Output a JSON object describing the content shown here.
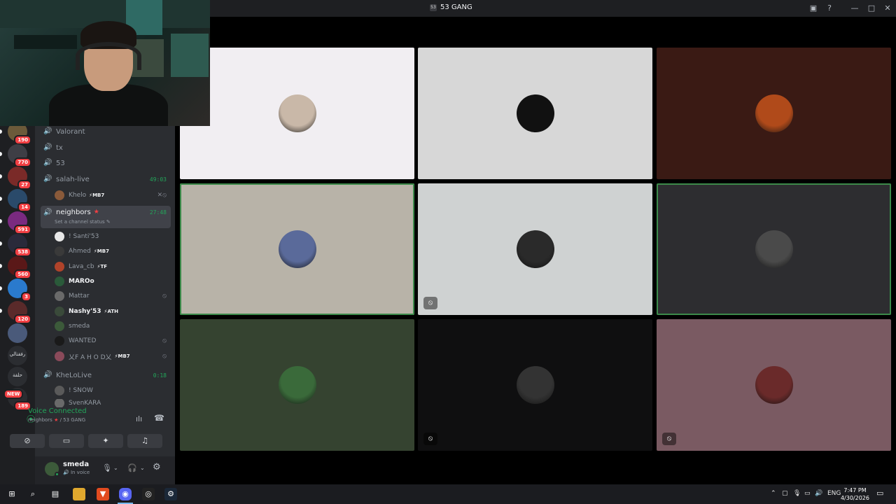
{
  "window": {
    "title": "53 GANG",
    "logo_text": "53"
  },
  "rail": {
    "servers": [
      {
        "name": "server-1",
        "badge": "190",
        "color": "#6b5a3a"
      },
      {
        "name": "server-2",
        "badge": "770",
        "color": "#3e3e45"
      },
      {
        "name": "server-3",
        "badge": "27",
        "color": "#7a2a28"
      },
      {
        "name": "server-4",
        "badge": "14",
        "color": "#2a4a6a"
      },
      {
        "name": "server-5",
        "badge": "591",
        "color": "#7a2a80"
      },
      {
        "name": "server-6",
        "badge": "538",
        "color": "#2a2a3a"
      },
      {
        "name": "server-7",
        "badge": "560",
        "color": "#5a1818"
      },
      {
        "name": "server-8",
        "badge": "3",
        "color": "#2a7acd"
      },
      {
        "name": "server-9",
        "badge": "120",
        "color": "#5a2a2a"
      },
      {
        "name": "server-10",
        "badge": "",
        "color": "#4a5a7a"
      },
      {
        "name": "server-11",
        "badge": "",
        "color": "#2b2d31",
        "label": "رفقتالي"
      },
      {
        "name": "server-12",
        "badge": "",
        "color": "#2b2d31",
        "label": "حلقة"
      },
      {
        "name": "server-13",
        "badge": "189",
        "new": "NEW",
        "color": "#2b2d31"
      }
    ]
  },
  "channels": [
    {
      "name": "Valorant",
      "time": ""
    },
    {
      "name": "tx",
      "time": ""
    },
    {
      "name": "53",
      "time": ""
    },
    {
      "name": "salah-live",
      "time": "49:03"
    }
  ],
  "salah_users": [
    {
      "name": "Khelo",
      "tag": "MB7"
    }
  ],
  "active_channel": {
    "name": "neighbors",
    "time": "27:48",
    "status": "Set a channel status"
  },
  "neighbors_users": [
    {
      "name": "! Santi'53",
      "tag": "",
      "color": "#e8e8e8"
    },
    {
      "name": "Ahmed",
      "tag": "MB7",
      "color": "#3a3a3a"
    },
    {
      "name": "Lava_cb",
      "tag": "TF",
      "color": "#b0432a"
    },
    {
      "name": "MAROo",
      "tag": "",
      "color": "#2a5a3a"
    },
    {
      "name": "Mattar",
      "tag": "",
      "color": "#6a6a6a"
    },
    {
      "name": "Nashy'53",
      "tag": "ATH",
      "color": "#3a4a3a"
    },
    {
      "name": "smeda",
      "tag": "",
      "color": "#3c5a3a"
    },
    {
      "name": "WANTED",
      "tag": "",
      "color": "#1a1a1a"
    },
    {
      "name": "乂F A H O D乂",
      "tag": "MB7",
      "color": "#8a4a5a"
    }
  ],
  "khelolive": {
    "name": "KheLoLive",
    "time": "0:18",
    "users": [
      "! SNOW",
      "SvenKARA"
    ]
  },
  "voice": {
    "status": "Voice Connected",
    "location": "neighbors",
    "server": "/ 53 GANG"
  },
  "me": {
    "name": "smeda",
    "status": "In voice"
  },
  "tiles": [
    {
      "bg": "#f1eef2",
      "avatar": "#c9b8a8",
      "speaking": false,
      "muted": false
    },
    {
      "bg": "#d7d7d7",
      "avatar": "#111111",
      "speaking": false,
      "muted": false
    },
    {
      "bg": "#3a1a14",
      "avatar": "#b04a1a",
      "speaking": false,
      "muted": false
    },
    {
      "bg": "#b8b3a8",
      "avatar": "#5a6a9a",
      "speaking": true,
      "muted": false
    },
    {
      "bg": "#cfd2d2",
      "avatar": "#2a2a2a",
      "speaking": false,
      "muted": true
    },
    {
      "bg": "#2d2d30",
      "avatar": "#4a4a4a",
      "speaking": true,
      "muted": false
    },
    {
      "bg": "#354330",
      "avatar": "#3a6a3a",
      "speaking": false,
      "muted": false
    },
    {
      "bg": "#0f0f10",
      "avatar": "#333333",
      "speaking": false,
      "muted": true
    },
    {
      "bg": "#7a5a62",
      "avatar": "#6a2a2a",
      "speaking": false,
      "muted": true
    }
  ],
  "taskbar": {
    "lang": "ENG",
    "time": "7:47 PM",
    "date": "4/30/2026"
  }
}
